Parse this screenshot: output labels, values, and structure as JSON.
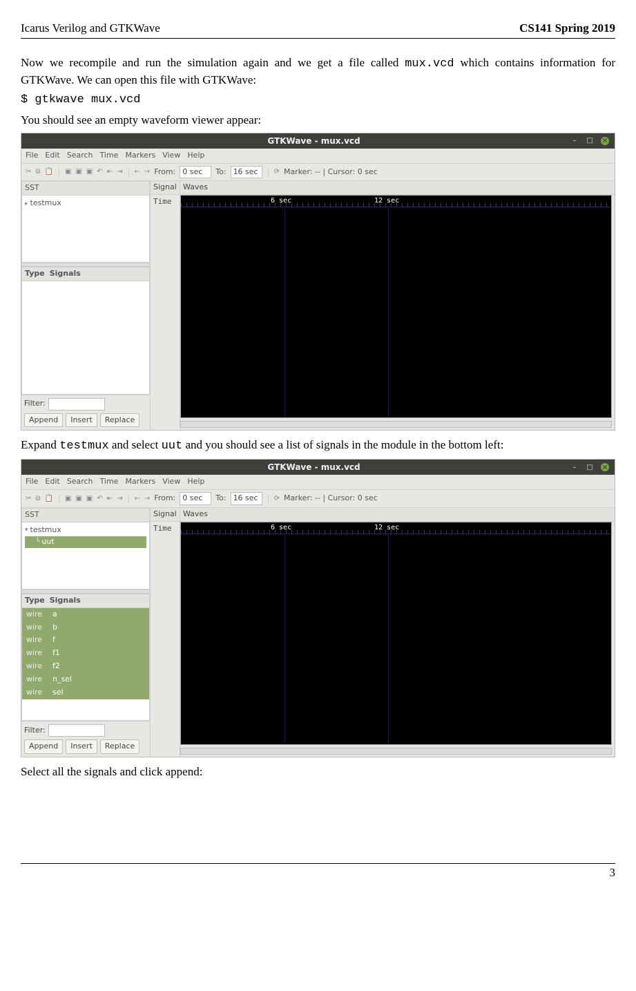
{
  "header": {
    "left": "Icarus Verilog and GTKWave",
    "right": "CS141 Spring 2019"
  },
  "body": {
    "p1a": "Now we recompile and run the simulation again and we get a file called ",
    "p1b": "mux.vcd",
    "p1c": " which contains information for GTKWave. We can open this file with GTKWave:",
    "cmd": "$ gtkwave mux.vcd",
    "p2": "You should see an empty waveform viewer appear:",
    "p3a": "Expand ",
    "p3b": "testmux",
    "p3c": " and select ",
    "p3d": "uut",
    "p3e": " and you should see a list of signals in the module in the bottom left:",
    "p4": "Select all the signals and click append:"
  },
  "gtk": {
    "title": "GTKWave - mux.vcd",
    "menu": [
      "File",
      "Edit",
      "Search",
      "Time",
      "Markers",
      "View",
      "Help"
    ],
    "toolbar": {
      "from_label": "From:",
      "from_value": "0 sec",
      "to_label": "To:",
      "to_value": "16 sec",
      "marker": "Marker: -- | Cursor: 0 sec"
    },
    "pane": {
      "sst": "SST",
      "signal": "Signal",
      "waves": "Waves",
      "time": "Time",
      "type": "Type",
      "signals": "Signals",
      "filter": "Filter:",
      "append": "Append",
      "insert": "Insert",
      "replace": "Replace"
    },
    "tree1": {
      "root": "testmux"
    },
    "tree2": {
      "root": "testmux",
      "child": "uut"
    },
    "signals2": [
      {
        "type": "wire",
        "name": "a"
      },
      {
        "type": "wire",
        "name": "b"
      },
      {
        "type": "wire",
        "name": "f"
      },
      {
        "type": "wire",
        "name": "f1"
      },
      {
        "type": "wire",
        "name": "f2"
      },
      {
        "type": "wire",
        "name": "n_sel"
      },
      {
        "type": "wire",
        "name": "sel"
      }
    ],
    "ruler": {
      "tick1": "6 sec",
      "tick2": "12 sec"
    }
  },
  "footer": {
    "page": "3"
  }
}
